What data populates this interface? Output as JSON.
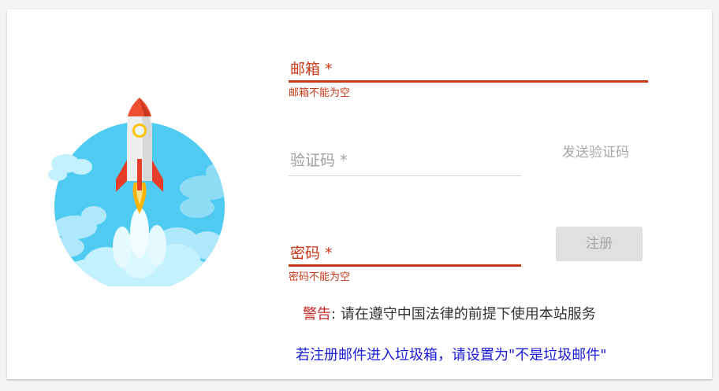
{
  "form": {
    "email": {
      "label": "邮箱 *",
      "error": "邮箱不能为空"
    },
    "code": {
      "label": "验证码 *"
    },
    "send_code_label": "发送验证码",
    "password": {
      "label": "密码 *",
      "error": "密码不能为空"
    },
    "register_label": "注册"
  },
  "notice": {
    "warning_label": "警告",
    "warning_colon": ":",
    "warning_text": "请在遵守中国法律的前提下使用本站服务",
    "spam_text": "若注册邮件进入垃圾箱，请设置为\"不是垃圾邮件\""
  },
  "illustration": {
    "icon": "rocket-launch-icon"
  },
  "colors": {
    "error": "#c8391a",
    "link_blue": "#1a1ad6",
    "sky": "#4fc9ef",
    "cloud": "#c3f1fd",
    "rocket_red": "#ee4e31"
  }
}
